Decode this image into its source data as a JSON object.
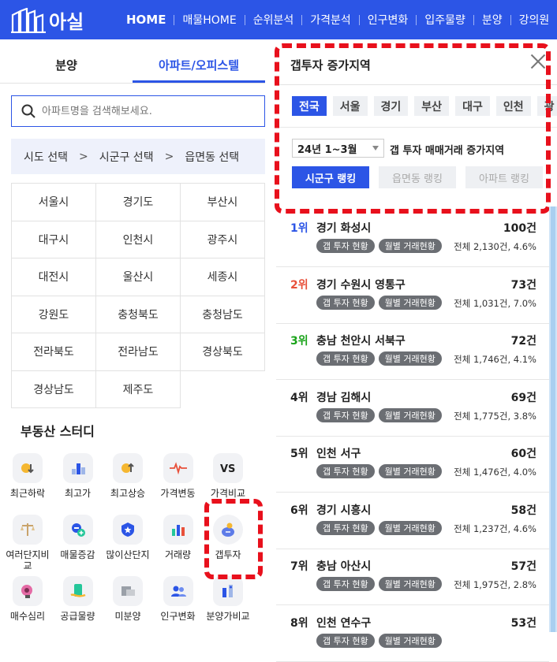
{
  "header": {
    "logo_text": "아실",
    "nav": [
      "HOME",
      "매물HOME",
      "순위분석",
      "가격분석",
      "인구변화",
      "입주물량",
      "분양",
      "강의원"
    ]
  },
  "left": {
    "tabs": [
      "분양",
      "아파트/오피스텔"
    ],
    "search_placeholder": "아파트명을 검색해보세요.",
    "breadcrumb": [
      "시도 선택",
      "시군구 선택",
      "읍면동 선택"
    ],
    "regions": [
      "서울시",
      "경기도",
      "부산시",
      "대구시",
      "인천시",
      "광주시",
      "대전시",
      "울산시",
      "세종시",
      "강원도",
      "충청북도",
      "충청남도",
      "전라북도",
      "전라남도",
      "경상북도",
      "경상남도",
      "제주도"
    ],
    "study_title": "부동산 스터디",
    "study_items": [
      {
        "label": "최근하락",
        "icon": "price-down-icon"
      },
      {
        "label": "최고가",
        "icon": "top-price-icon"
      },
      {
        "label": "최고상승",
        "icon": "price-up-icon"
      },
      {
        "label": "가격변동",
        "icon": "price-change-icon"
      },
      {
        "label": "가격비교",
        "icon": "versus-icon"
      },
      {
        "label": "여러단지비교",
        "icon": "scale-icon"
      },
      {
        "label": "매물증감",
        "icon": "listing-change-icon"
      },
      {
        "label": "많이산단지",
        "icon": "popular-complex-icon"
      },
      {
        "label": "거래량",
        "icon": "volume-chart-icon"
      },
      {
        "label": "갭투자",
        "icon": "gap-investment-icon"
      },
      {
        "label": "매수심리",
        "icon": "buyer-sentiment-icon"
      },
      {
        "label": "공급물량",
        "icon": "supply-icon"
      },
      {
        "label": "미분양",
        "icon": "unsold-icon"
      },
      {
        "label": "인구변화",
        "icon": "population-icon"
      },
      {
        "label": "분양가비교",
        "icon": "presale-compare-icon"
      }
    ]
  },
  "panel": {
    "title": "갭투자 증가지역",
    "region_chips": [
      "전국",
      "서울",
      "경기",
      "부산",
      "대구",
      "인천",
      "광"
    ],
    "period": "24년 1~3월",
    "period_label": "갭 투자 매매거래 증가지역",
    "rank_tabs": [
      "시군구 랭킹",
      "읍면동 랭킹",
      "아파트 랭킹"
    ],
    "pill_gap": "갭 투자 현황",
    "pill_monthly": "월별 거래현황",
    "ranks": [
      {
        "rank": "1위",
        "name": "경기 화성시",
        "count": "100건",
        "total": "전체 2,130건, 4.6%",
        "color": "#2c55e6"
      },
      {
        "rank": "2위",
        "name": "경기 수원시 영통구",
        "count": "73건",
        "total": "전체 1,031건, 7.0%",
        "color": "#e8503a"
      },
      {
        "rank": "3위",
        "name": "충남 천안시 서북구",
        "count": "72건",
        "total": "전체 1,746건, 4.1%",
        "color": "#1aa31a"
      },
      {
        "rank": "4위",
        "name": "경남 김해시",
        "count": "69건",
        "total": "전체 1,775건, 3.8%",
        "color": "#222222"
      },
      {
        "rank": "5위",
        "name": "인천 서구",
        "count": "60건",
        "total": "전체 1,476건, 4.0%",
        "color": "#222222"
      },
      {
        "rank": "6위",
        "name": "경기 시흥시",
        "count": "58건",
        "total": "전체 1,237건, 4.6%",
        "color": "#222222"
      },
      {
        "rank": "7위",
        "name": "충남 아산시",
        "count": "57건",
        "total": "전체 1,975건, 2.8%",
        "color": "#222222"
      },
      {
        "rank": "8위",
        "name": "인천 연수구",
        "count": "53건",
        "total": "",
        "color": "#222222"
      }
    ]
  },
  "colors": {
    "brand": "#2c55e6",
    "highlight": "#e8101c"
  }
}
